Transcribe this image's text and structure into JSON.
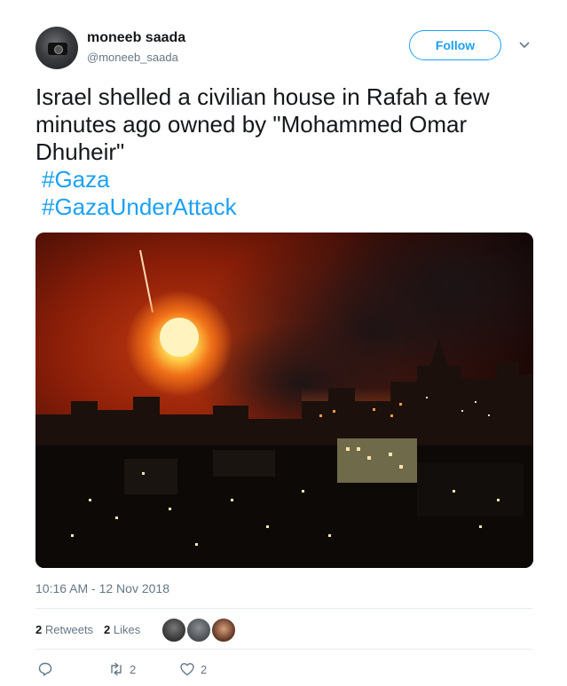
{
  "author": {
    "display_name": "moneeb saada",
    "handle": "@moneeb_saada",
    "avatar_icon": "photographer-avatar"
  },
  "follow_button": {
    "label": "Follow"
  },
  "tweet": {
    "text": "Israel shelled a civilian house in Rafah a few minutes ago owned by \"Mohammed Omar Dhuheir\"",
    "hashtags": [
      "#Gaza",
      "#GazaUnderAttack"
    ],
    "photo_description_icon": "night-airstrike-photo"
  },
  "timestamp": "10:16 AM - 12 Nov 2018",
  "stats": {
    "retweets_count": "2",
    "retweets_label": "Retweets",
    "likes_count": "2",
    "likes_label": "Likes"
  },
  "actions": {
    "reply_count": "",
    "retweet_count": "2",
    "like_count": "2"
  },
  "colors": {
    "link": "#1da1f2",
    "text": "#14171a",
    "secondary": "#657786",
    "divider": "#e6ecf0"
  }
}
